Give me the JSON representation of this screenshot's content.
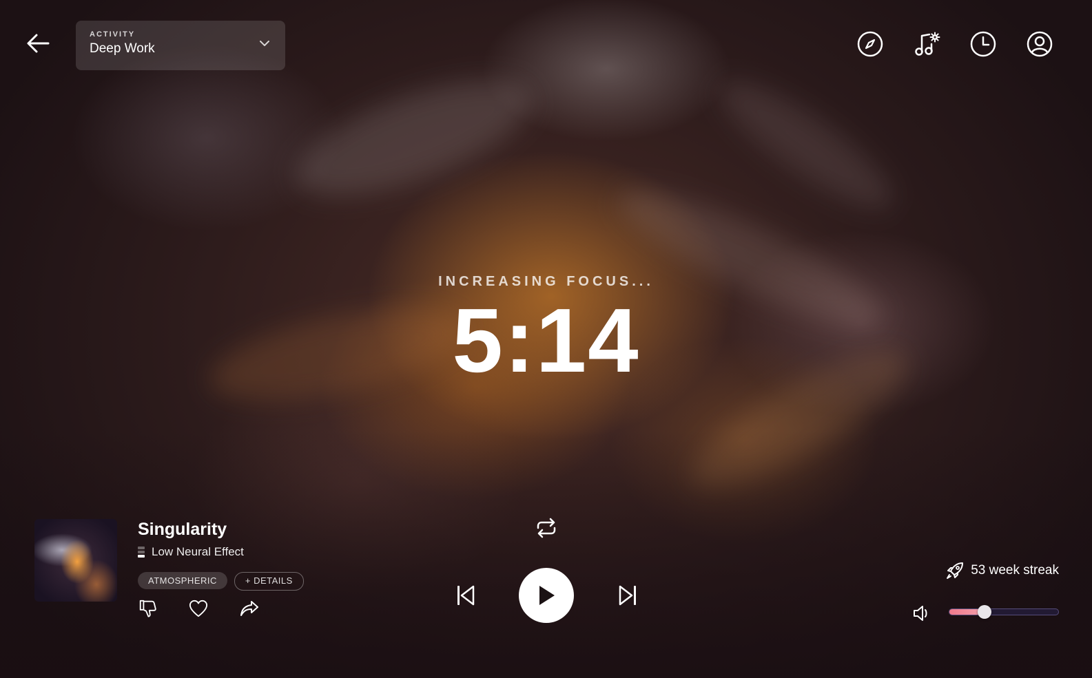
{
  "header": {
    "back_icon": "arrow-left-icon",
    "activity_label": "ACTIVITY",
    "activity_value": "Deep Work",
    "icons": [
      "compass-icon",
      "music-settings-icon",
      "clock-icon",
      "user-icon"
    ]
  },
  "center": {
    "status": "INCREASING FOCUS...",
    "timer": "5:14"
  },
  "track": {
    "title": "Singularity",
    "effect": "Low Neural Effect",
    "genre_chip": "ATMOSPHERIC",
    "details_chip": "+ DETAILS",
    "actions": [
      "thumbs-down-icon",
      "heart-icon",
      "share-icon"
    ]
  },
  "player": {
    "icons": [
      "repeat-icon",
      "skip-previous-icon",
      "play-icon",
      "skip-next-icon"
    ]
  },
  "streak": {
    "text": "53 week streak",
    "icon": "rocket-icon"
  },
  "volume": {
    "level": 0.32,
    "icon": "volume-icon"
  },
  "colors": {
    "accent": "#f07a8c",
    "background": "#2e1c1c",
    "glow": "#b06c26"
  }
}
